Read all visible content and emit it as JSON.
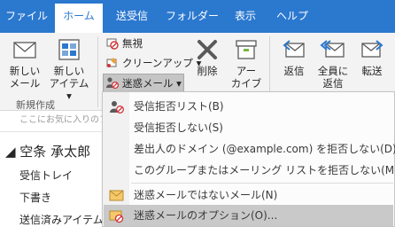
{
  "tabs": [
    {
      "label": "ファイル",
      "active": false
    },
    {
      "label": "ホーム",
      "active": true
    },
    {
      "label": "送受信",
      "active": false
    },
    {
      "label": "フォルダー",
      "active": false
    },
    {
      "label": "表示",
      "active": false
    },
    {
      "label": "ヘルプ",
      "active": false
    }
  ],
  "ribbon": {
    "new_group": {
      "new_mail_l1": "新しい",
      "new_mail_l2": "メール",
      "new_items_l1": "新しい",
      "new_items_l2": "アイテム ▾",
      "group_label": "新規作成"
    },
    "delete_group": {
      "ignore": "無視",
      "cleanup": "クリーンアップ ▾",
      "junk": "迷惑メール ▾",
      "delete": "削除",
      "archive_l1": "アー",
      "archive_l2": "カイブ"
    },
    "respond_group": {
      "reply": "返信",
      "reply_all_l1": "全員に",
      "reply_all_l2": "返信",
      "forward": "転送"
    }
  },
  "nav": {
    "favorites_placeholder": "ここにお気に入りのフ",
    "account": "◢ 空条 承太郎",
    "folders": [
      "受信トレイ",
      "下書き",
      "送信済みアイテム"
    ]
  },
  "junk_menu": {
    "items": [
      {
        "label": "受信拒否リスト(B)",
        "icon": "block-sender-icon"
      },
      {
        "label": "受信拒否しない(S)",
        "icon": ""
      },
      {
        "label": "差出人のドメイン (@example.com) を拒否しない(D)",
        "icon": ""
      },
      {
        "label": "このグループまたはメーリング リストを拒否しない(M)",
        "icon": ""
      },
      {
        "label": "迷惑メールではないメール(N)",
        "icon": "not-junk-icon"
      },
      {
        "label": "迷惑メールのオプション(O)...",
        "icon": "junk-options-icon",
        "highlighted": true
      }
    ]
  },
  "colors": {
    "tab_bar": "#2b78cf",
    "ribbon_bg": "#f3f3f3",
    "menu_highlight": "#c9c9c9",
    "block_red": "#d13438"
  }
}
